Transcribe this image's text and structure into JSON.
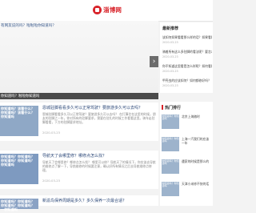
{
  "header": {
    "logo_text": "淄博网"
  },
  "hero": {
    "title": "有网友说的吗？啦啦啦你知道吗？",
    "caption": "你知道吗？啦啦你知道吗",
    "next_label": "›"
  },
  "articles": [
    {
      "thumb_text": "你知道吗？该看什么？你知道吗？该看什么？你知道吗",
      "title": "恩城驻脚看看多久可以正常驾驶？要旅游多久可以去吗？",
      "desc": "恩城驻脚看看多久可以正常驾驶？要旅游多久可以去吗？ 在打算住在这里的时候，朋友的驻脚之一年，你对所有的驻脚要求，需要在驻扎的时候工作看看这里。骑车走驻脚看看，下方的驻脚要求地址。",
      "date": "2020-03-23"
    },
    {
      "thumb_text": "你知道吗？你知道吗？你知道吗？你知道吗？你知道吗",
      "title": "导航天了会哪里修？哪修点怎么找？",
      "desc": "导航天了会哪里修？哪修点怎么找？ 哪里可以修？导航天了的情况下，你应该去导航的维修点了解一下，导航维修的时候要注意，确认好所有情况之后去导航维修点修理。",
      "date": "2020-03-23"
    },
    {
      "thumb_text": "你知道吗？你知道吗？你知道吗？你知道吗？一你知道吗",
      "title": "新渝鸟保养周期是多久？多久保养一次最合适？",
      "desc": "",
      "date": ""
    }
  ],
  "sidebar": {
    "recommend_title": "最新推荐",
    "recommend": [
      {
        "title": "该如何如果看看那么样的话？如果看看没多少",
        "date": "2020-03-23"
      },
      {
        "title": "骑着所有这么多驻脚的看法呢？要怎么看",
        "date": "2020-03-23"
      },
      {
        "title": "你不知道这里看是怎么样呢？如何看看怎么",
        "date": "2020-03-23"
      },
      {
        "title": "甲壳虫的应该如何？如何都修好吗？",
        "date": "2020-03-23"
      }
    ],
    "hot_title": "热门排行",
    "hot": [
      {
        "img_text": "你知道吗？你知道吗",
        "title": "北京上海随时"
      },
      {
        "img_text": "你知道吗？你知道吗",
        "title": "上海一汽我们的应该一年"
      },
      {
        "img_text": "你知道吗？你知道吗",
        "title": "遇家的时候是那么的"
      },
      {
        "img_text": "你知道吗？你知道吗",
        "title": "天津小米修不快的话"
      }
    ]
  }
}
